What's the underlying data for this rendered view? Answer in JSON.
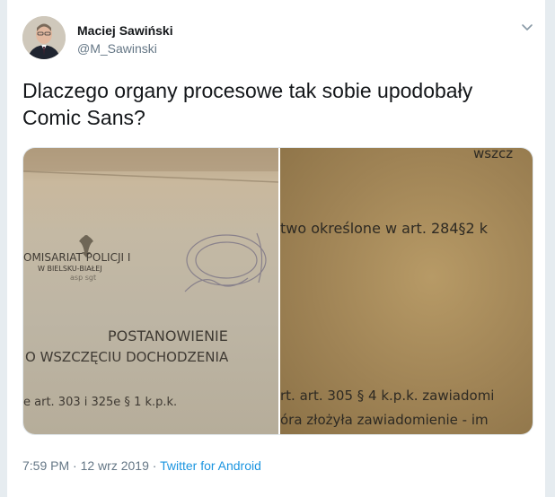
{
  "user": {
    "name": "Maciej Sawiński",
    "handle": "@M_Sawinski"
  },
  "tweet": {
    "text": "Dlaczego organy procesowe tak sobie upodobały Comic Sans?"
  },
  "media": {
    "left_photo": {
      "line1": "OMISARIAT POLICJI I",
      "line2": "W BIELSKU-BIAŁEJ",
      "line3": "POSTANOWIENIE",
      "line4": "O WSZCZĘCIU DOCHODZENIA",
      "line5": "e art. 303 i 325e § 1 k.p.k."
    },
    "right_photo": {
      "line1": "wszcz",
      "line2": "two określone w art. 284§2 k",
      "line3": "rt. art. 305 § 4 k.p.k. zawiadomi",
      "line4": "óra złożyła zawiadomienie - im"
    }
  },
  "footer": {
    "time": "7:59 PM",
    "dot": "·",
    "date": "12 wrz 2019",
    "source": "Twitter for Android"
  },
  "colors": {
    "name": "#14171a",
    "secondary": "#657786",
    "link": "#1b95e0",
    "border": "#e6ecf0"
  },
  "icons": {
    "menu": "chevron-down-icon"
  }
}
